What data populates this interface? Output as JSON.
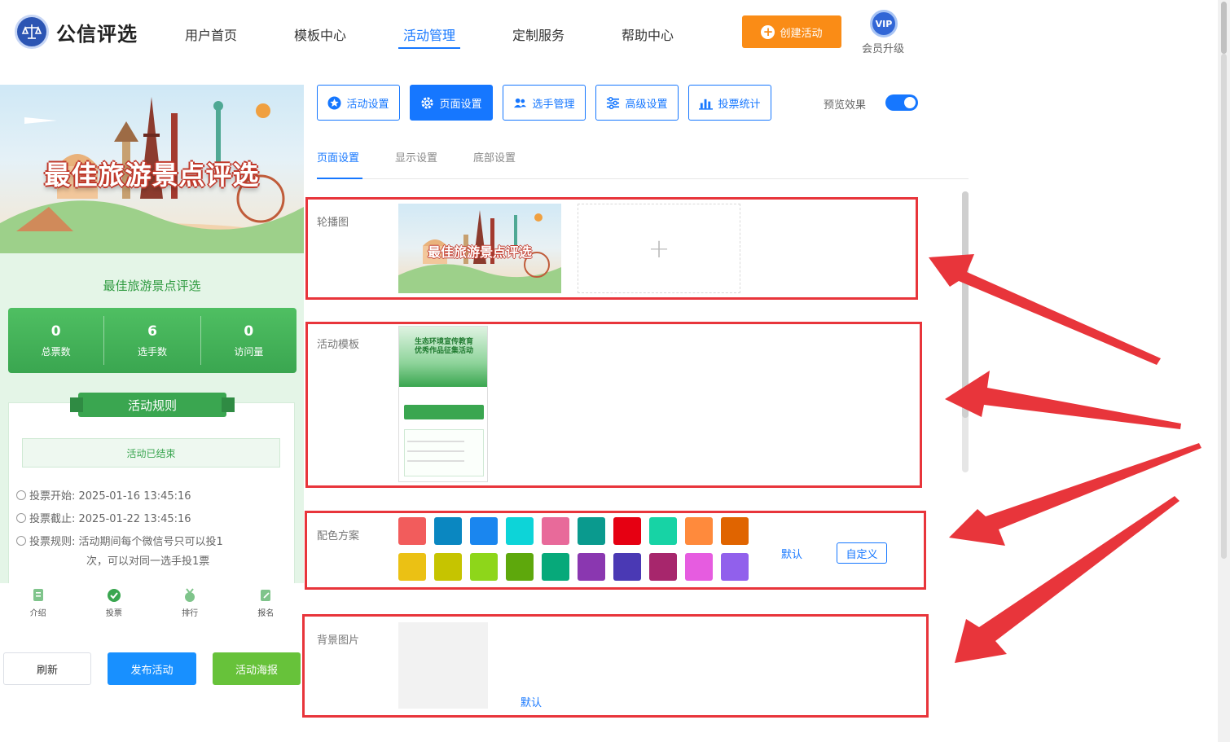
{
  "brand": {
    "name": "公信评选"
  },
  "nav": {
    "items": [
      {
        "label": "用户首页",
        "active": false
      },
      {
        "label": "模板中心",
        "active": false
      },
      {
        "label": "活动管理",
        "active": true
      },
      {
        "label": "定制服务",
        "active": false
      },
      {
        "label": "帮助中心",
        "active": false
      }
    ],
    "create_label": "创建活动",
    "vip_badge": "VIP",
    "vip_label": "会员升级"
  },
  "preview": {
    "banner_title": "最佳旅游景点评选",
    "activity_title": "最佳旅游景点评选",
    "stats": [
      {
        "value": "0",
        "label": "总票数"
      },
      {
        "value": "6",
        "label": "选手数"
      },
      {
        "value": "0",
        "label": "访问量"
      }
    ],
    "rules_title": "活动规则",
    "status": "活动已结束",
    "vote_start": "投票开始:  2025-01-16 13:45:16",
    "vote_end": "投票截止:  2025-01-22 13:45:16",
    "vote_rule_1": "投票规则:  活动期间每个微信号只可以投1",
    "vote_rule_2": "次，可以对同一选手投1票",
    "tabs": [
      {
        "label": "介绍"
      },
      {
        "label": "投票"
      },
      {
        "label": "排行"
      },
      {
        "label": "报名"
      }
    ],
    "buttons": {
      "refresh": "刷新",
      "publish": "发布活动",
      "poster": "活动海报"
    }
  },
  "toolbar": {
    "buttons": [
      {
        "label": "活动设置",
        "icon": "star-icon",
        "active": false
      },
      {
        "label": "页面设置",
        "icon": "gear-icon",
        "active": true
      },
      {
        "label": "选手管理",
        "icon": "users-icon",
        "active": false
      },
      {
        "label": "高级设置",
        "icon": "sliders-icon",
        "active": false
      },
      {
        "label": "投票统计",
        "icon": "bar-chart-icon",
        "active": false
      }
    ],
    "preview_label": "预览效果",
    "preview_on": true
  },
  "subtabs": [
    {
      "label": "页面设置",
      "active": true
    },
    {
      "label": "显示设置",
      "active": false
    },
    {
      "label": "底部设置",
      "active": false
    }
  ],
  "sections": {
    "carousel_label": "轮播图",
    "carousel_thumb_title": "最佳旅游景点评选",
    "template_label": "活动模板",
    "template_thumb_title_1": "生态环境宣传教育",
    "template_thumb_title_2": "优秀作品征集活动",
    "color_label": "配色方案",
    "color_default": "默认",
    "color_custom": "自定义",
    "bg_label": "背景图片",
    "bg_default": "默认"
  },
  "colors": {
    "row1": [
      "#f25c5c",
      "#0a87c1",
      "#1a86ef",
      "#0dd4d8",
      "#e86a9a",
      "#0a9a8e",
      "#e60012",
      "#17d3a5",
      "#ff8a3c",
      "#e06400"
    ],
    "row2": [
      "#ebc114",
      "#c6c400",
      "#8ed61a",
      "#5ea80c",
      "#07a97a",
      "#8a37b0",
      "#4a39b4",
      "#a7266c",
      "#e65ce0",
      "#9160ec"
    ],
    "accent": "#1677ff",
    "highlight": "#e8353b"
  }
}
